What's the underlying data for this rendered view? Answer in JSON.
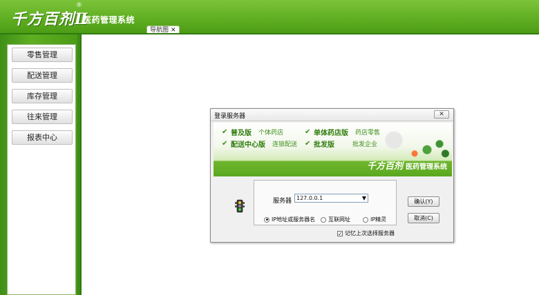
{
  "header": {
    "logo_text": "千方百剂",
    "logo_mark": "Ⅱ",
    "registered": "®",
    "subtitle": "医药管理系统",
    "tab_label": "导航图",
    "tab_close": "✕"
  },
  "sidebar": {
    "items": [
      {
        "label": "零售管理"
      },
      {
        "label": "配送管理"
      },
      {
        "label": "库存管理"
      },
      {
        "label": "往来管理"
      },
      {
        "label": "报表中心"
      }
    ]
  },
  "dialog": {
    "title": "登录服务器",
    "close_label": "✕",
    "banner": {
      "features": [
        {
          "label": "普及版",
          "sub": "个体药店",
          "checked": true
        },
        {
          "label": "单体药店版",
          "sub": "药店零售",
          "checked": true
        },
        {
          "label": "配送中心版",
          "sub": "连锁配送",
          "checked": true
        },
        {
          "label": "批发版",
          "sub": "批发企业",
          "checked": true
        }
      ],
      "brand_logo": "千方百剂",
      "brand_text": "医药管理系统"
    },
    "server_label": "服务器",
    "server_value": "127.0.0.1",
    "radios": [
      {
        "label": "IP地址或服务器名",
        "selected": true
      },
      {
        "label": "互联网址",
        "selected": false
      },
      {
        "label": "IP精灵",
        "selected": false
      }
    ],
    "confirm_label": "确认(Y)",
    "cancel_label": "取消(C)",
    "remember_label": "记忆上次选择服务器",
    "remember_checked": true
  },
  "colors": {
    "brand_green": "#5fae22",
    "dark_green": "#2f7a0e"
  }
}
